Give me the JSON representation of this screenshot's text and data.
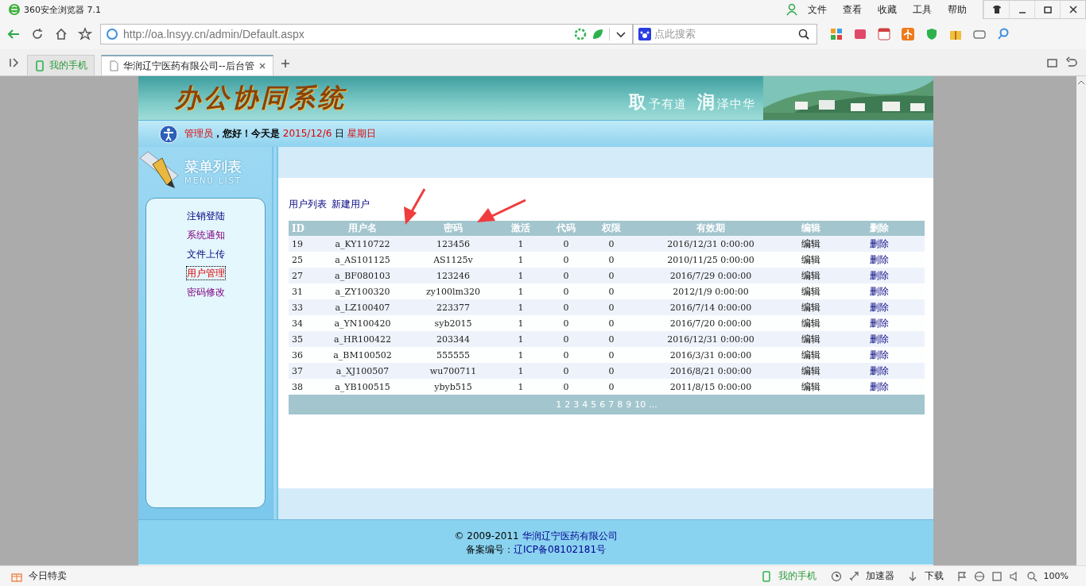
{
  "browser": {
    "title": "360安全浏览器 7.1",
    "menu": [
      "文件",
      "查看",
      "收藏",
      "工具",
      "帮助"
    ],
    "address": "http://oa.lnsyy.cn/admin/Default.aspx",
    "search_placeholder": "点此搜索",
    "tabs": [
      {
        "label": "我的手机",
        "kind": "phone",
        "selected": false
      },
      {
        "label": "华润辽宁医药有限公司--后台管",
        "kind": "page",
        "selected": true
      }
    ],
    "status_bar": {
      "left": "今日特卖",
      "items": [
        "我的手机",
        "加速器",
        "下载"
      ],
      "zoom": "100%"
    }
  },
  "banner": {
    "title": "办公协同系统",
    "slogan": [
      {
        "big": "取",
        "small": "予有道"
      },
      {
        "big": "润",
        "small": "泽中华"
      }
    ]
  },
  "greeting": {
    "user": "管理员",
    "text": "，您好！今天是",
    "date": "2015/12/6",
    "day_label": "日",
    "weekday": "星期日"
  },
  "sidebar": {
    "title": "菜单列表",
    "subtitle": "MENU LIST",
    "items": [
      {
        "label": "注销登陆",
        "visited": false,
        "selected": false
      },
      {
        "label": "系统通知",
        "visited": true,
        "selected": false
      },
      {
        "label": "文件上传",
        "visited": false,
        "selected": false
      },
      {
        "label": "用户管理",
        "visited": false,
        "selected": true
      },
      {
        "label": "密码修改",
        "visited": true,
        "selected": false
      }
    ]
  },
  "links": [
    "用户列表",
    "新建用户"
  ],
  "table": {
    "columns": [
      {
        "label": "ID",
        "kind": "text"
      },
      {
        "label": "用户名",
        "kind": "text"
      },
      {
        "label": "密码",
        "kind": "text"
      },
      {
        "label": "激活",
        "kind": "text"
      },
      {
        "label": "代码",
        "kind": "text"
      },
      {
        "label": "权限",
        "kind": "text"
      },
      {
        "label": "有效期",
        "kind": "text"
      },
      {
        "label": "编辑",
        "kind": "action"
      },
      {
        "label": "删除",
        "kind": "link"
      }
    ],
    "rows": [
      [
        "19",
        "a_KY110722",
        "123456",
        "1",
        "0",
        "0",
        "2016/12/31 0:00:00",
        "编辑",
        "删除"
      ],
      [
        "25",
        "a_AS101125",
        "AS1125v",
        "1",
        "0",
        "0",
        "2010/11/25 0:00:00",
        "编辑",
        "删除"
      ],
      [
        "27",
        "a_BF080103",
        "123246",
        "1",
        "0",
        "0",
        "2016/7/29 0:00:00",
        "编辑",
        "删除"
      ],
      [
        "31",
        "a_ZY100320",
        "zy100lm320",
        "1",
        "0",
        "0",
        "2012/1/9 0:00:00",
        "编辑",
        "删除"
      ],
      [
        "33",
        "a_LZ100407",
        "223377",
        "1",
        "0",
        "0",
        "2016/7/14 0:00:00",
        "编辑",
        "删除"
      ],
      [
        "34",
        "a_YN100420",
        "syb2015",
        "1",
        "0",
        "0",
        "2016/7/20 0:00:00",
        "编辑",
        "删除"
      ],
      [
        "35",
        "a_HR100422",
        "203344",
        "1",
        "0",
        "0",
        "2016/12/31 0:00:00",
        "编辑",
        "删除"
      ],
      [
        "36",
        "a_BM100502",
        "555555",
        "1",
        "0",
        "0",
        "2016/3/31 0:00:00",
        "编辑",
        "删除"
      ],
      [
        "37",
        "a_XJ100507",
        "wu700711",
        "1",
        "0",
        "0",
        "2016/8/21 0:00:00",
        "编辑",
        "删除"
      ],
      [
        "38",
        "a_YB100515",
        "ybyb515",
        "1",
        "0",
        "0",
        "2011/8/15 0:00:00",
        "编辑",
        "删除"
      ]
    ],
    "pages": [
      "1",
      "2",
      "3",
      "4",
      "5",
      "6",
      "7",
      "8",
      "9",
      "10",
      "..."
    ]
  },
  "footer": {
    "copyright": "© 2009-2011",
    "company": "华润辽宁医药有限公司",
    "record_label": "备案编号：",
    "record": "辽ICP备08102181号"
  }
}
